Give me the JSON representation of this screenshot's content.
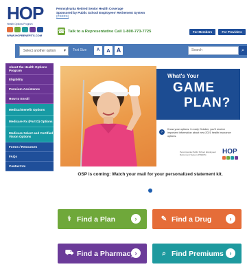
{
  "brand": {
    "logo": "HOP",
    "logo_sub": "Health Options Program",
    "url": "WWW.HOPBENEFITS.COM",
    "program_line1": "Pennsylvania Retired Senior Health Coverage",
    "program_line2": "Sponsored by Public School Employees' Retirement System",
    "program_link": "(PSERS)",
    "colors": {
      "primary": "#1f3e86",
      "green": "#6fa83a",
      "orange": "#e56d39",
      "purple": "#6b3b99",
      "teal": "#1e9a9f"
    }
  },
  "header": {
    "phone_icon": "phone-icon",
    "phone_text": "Talk to a Representative Call 1-800-773-7725",
    "btn_members": "For Members",
    "btn_providers": "For Providers"
  },
  "toolbar": {
    "language_select": "Select another option",
    "text_size_label": "Text Size",
    "text_size_buttons": [
      "A",
      "A",
      "A"
    ],
    "search_placeholder": "Search",
    "search_icon": "magnifier-icon"
  },
  "sidebar": {
    "items": [
      "About the Health Options Program",
      "Eligibility",
      "Premium Assistance",
      "How to Enroll",
      "Medical Benefit Options",
      "Medicare Rx (Part D) Options",
      "Medicare Select and Certified Vision Options",
      "Forms / Resources",
      "FAQs",
      "Contact Us"
    ]
  },
  "hero": {
    "headline_1": "What's Your",
    "headline_2": "GAME",
    "headline_3": "PLAN?",
    "description": "Know your options. In early October, you'll receive important information about new 2021 health insurance options.",
    "small_print": "Pennsylvania Public School Employees' Retirement System (PSERS)",
    "mini_logo": "HOP"
  },
  "caption": "OSP is coming: Watch your mail for your personalized statement kit.",
  "carousel": {
    "current": 1,
    "total": 1
  },
  "actions": [
    {
      "label": "Find a Plan",
      "icon": "stethoscope-icon"
    },
    {
      "label": "Find a Drug",
      "icon": "pill-icon"
    },
    {
      "label": "Find a Pharmacy",
      "icon": "pharmacy-cart-icon"
    },
    {
      "label": "Find Premiums",
      "icon": "magnifier-icon"
    }
  ]
}
